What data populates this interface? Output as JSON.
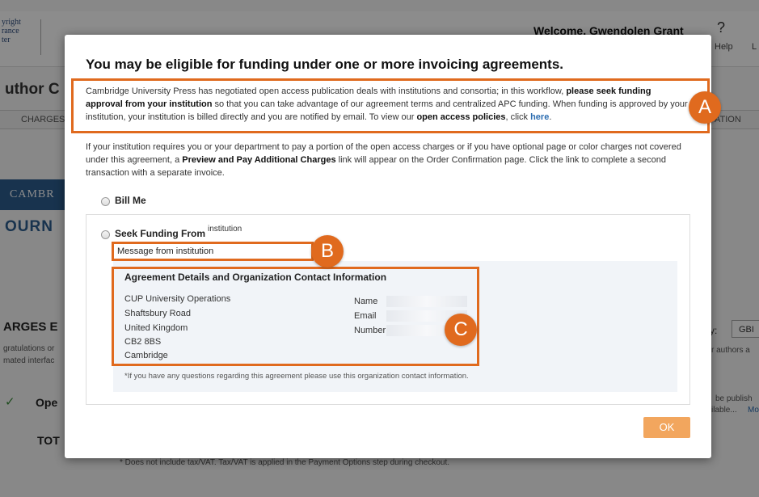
{
  "background": {
    "logo_lines": [
      "yright",
      "rance",
      "ter"
    ],
    "welcome": "Welcome, Gwendolen Grant",
    "help_icon": "?",
    "help_label": "Help",
    "help_label_2": "L",
    "page_title": "uthor C",
    "tab_left": "CHARGES",
    "tab_right": "ATION",
    "banner_text": "CAMBR",
    "journal_text": "OURN",
    "charges_heading": "ARGES E",
    "congrats_line1": "gratulations or",
    "congrats_line2": "mated interfac",
    "check_icon": "✓",
    "open_label": "Ope",
    "total_label": "TOT",
    "footnote": "* Does not include tax/VAT. Tax/VAT is applied in the Payment Options step during checkout.",
    "currency_label": "cy:",
    "currency_value": "GBI",
    "authors_text": "r authors a",
    "publish_1": "be publish",
    "publish_2": "ilable...",
    "more_link": "Mo"
  },
  "modal": {
    "title": "You may be eligible for funding under one or more invoicing agreements.",
    "intro": {
      "t1": "Cambridge University Press has negotiated open access publication deals with institutions and consortia; in this workflow, ",
      "b1": "please seek funding approval from your institution",
      "t2": " so that you can take advantage of our agreement terms and centralized APC funding. When funding is approved by your institution, your institution is billed directly and you are notified by email. To view our ",
      "b2": "open access policies",
      "t3": ", click ",
      "link": "here",
      "t4": "."
    },
    "additional": {
      "t1": "If your institution requires you or your department to pay a portion of the open access charges or if you have optional page or color charges not covered under this agreement, a ",
      "b1": "Preview and Pay Additional Charges",
      "t2": " link will appear on the Order Confirmation page. Click the link to complete a second transaction with a separate invoice."
    },
    "bill_me_label": "Bill Me",
    "seek_funding_label": "Seek Funding From",
    "institution_label": "institution",
    "message_text": "Message from institution",
    "details_title": "Agreement Details and Organization Contact Information",
    "address": [
      "CUP University Operations",
      "Shaftsbury Road",
      "United Kingdom",
      "CB2 8BS",
      "Cambridge"
    ],
    "contact_labels": [
      "Name",
      "Email",
      "Number"
    ],
    "disclaimer": "*If you have any questions regarding this agreement please use this organization contact information.",
    "ok_label": "OK"
  },
  "annotations": {
    "a": "A",
    "b": "B",
    "c": "C"
  },
  "colors": {
    "accent": "#e06a1e",
    "ok_button": "#f2a65e",
    "link": "#2b6cb0"
  }
}
